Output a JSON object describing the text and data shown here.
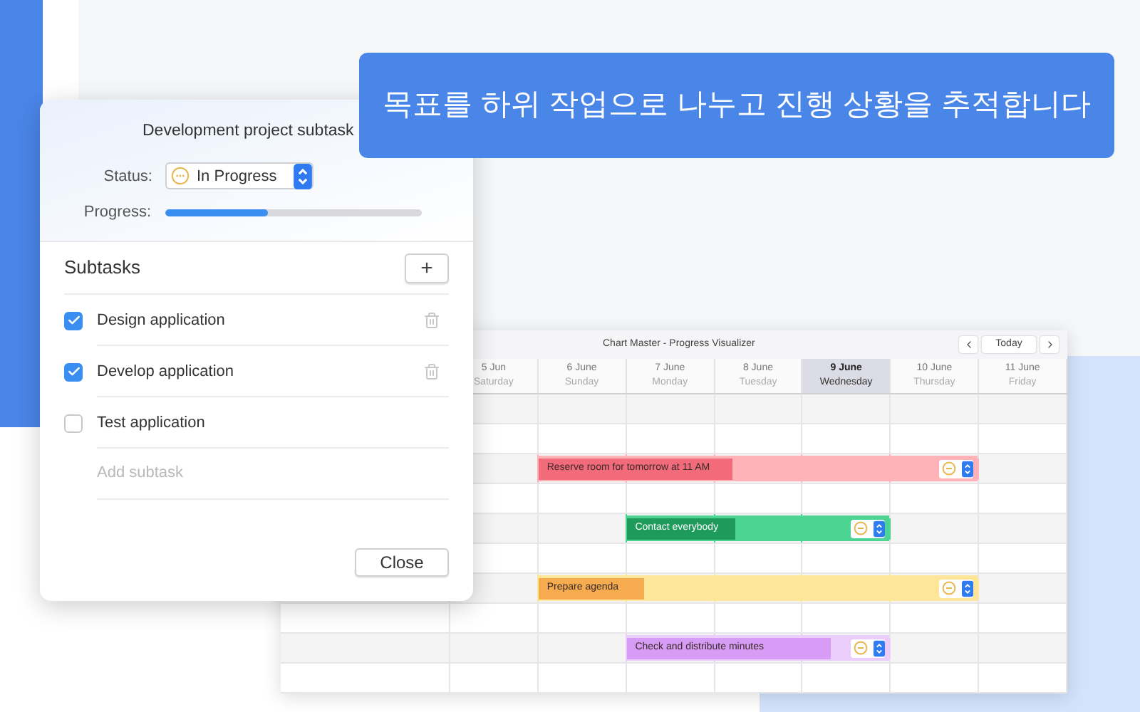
{
  "banner": {
    "text": "목표를 하위 작업으로 나누고 진행 상황을 추적합니다"
  },
  "dialog": {
    "title": "Development project subtask",
    "status_label": "Status:",
    "status": "In Progress",
    "progress_label": "Progress:",
    "progress": {
      "level": 0.4
    },
    "subtasks_heading": "Subtasks",
    "add_button": "+",
    "subtasks": [
      {
        "label": "Design application",
        "checked": true,
        "deletable": true
      },
      {
        "label": "Develop application",
        "checked": true,
        "deletable": true
      },
      {
        "label": "Test application",
        "checked": false,
        "deletable": false
      }
    ],
    "add_placeholder": "Add subtask",
    "close_button": "Close"
  },
  "calendar": {
    "title": "Chart Master - Progress Visualizer",
    "today_button": "Today",
    "days": [
      {
        "date": "5 Jun",
        "weekday": "Saturday",
        "selected": false
      },
      {
        "date": "6 June",
        "weekday": "Sunday",
        "selected": false
      },
      {
        "date": "7 June",
        "weekday": "Monday",
        "selected": false
      },
      {
        "date": "8 June",
        "weekday": "Tuesday",
        "selected": false
      },
      {
        "date": "9 June",
        "weekday": "Wednesday",
        "selected": true
      },
      {
        "date": "10 June",
        "weekday": "Thursday",
        "selected": false
      },
      {
        "date": "11 June",
        "weekday": "Friday",
        "selected": false
      }
    ],
    "rows": [
      {
        "kind": "empty"
      },
      {
        "kind": "empty"
      },
      {
        "kind": "task",
        "label": "Reserve room for tomorrow at 11 AM",
        "color": "#f26b7a",
        "track": {
          "color": "#ffb3b8"
        },
        "level": 0.44,
        "days": [
          false,
          true,
          true,
          true,
          true,
          true,
          false
        ]
      },
      {
        "kind": "empty"
      },
      {
        "kind": "task",
        "label": "Contact everybody",
        "color": "#1e9a5a",
        "track": {
          "color": "#4cd493"
        },
        "level": 0.41,
        "days": [
          false,
          false,
          true,
          true,
          true,
          false,
          false
        ]
      },
      {
        "kind": "empty"
      },
      {
        "kind": "task",
        "label": "Prepare agenda",
        "color": "#f5ab4e",
        "track": {
          "color": "#fde59a"
        },
        "level": 0.24,
        "days": [
          false,
          true,
          true,
          true,
          true,
          true,
          false
        ]
      },
      {
        "kind": "empty"
      },
      {
        "kind": "task",
        "label": "Check and distribute minutes",
        "color": "#d79cf5",
        "track": {
          "color": "#ebcdfb"
        },
        "level": 0.77,
        "days": [
          false,
          false,
          true,
          true,
          true,
          false,
          false
        ]
      },
      {
        "kind": "empty"
      }
    ]
  }
}
